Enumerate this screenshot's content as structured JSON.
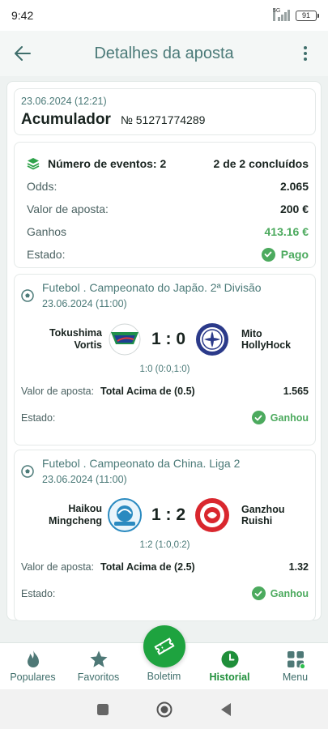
{
  "status_bar": {
    "time": "9:42",
    "network": "5G",
    "battery": "91"
  },
  "header": {
    "title": "Detalhes da aposta",
    "back_icon": "arrow-left-icon",
    "menu_icon": "more-vertical-icon"
  },
  "bet": {
    "date": "23.06.2024 (12:21)",
    "type": "Acumulador",
    "number": "№ 51271774289"
  },
  "summary": {
    "events_label": "Número de eventos: 2",
    "events_status": "2 de 2 concluídos",
    "rows": [
      {
        "label": "Odds:",
        "value": "2.065"
      },
      {
        "label": "Valor de aposta:",
        "value": "200 €"
      },
      {
        "label": "Ganhos",
        "value": "413.16 €"
      },
      {
        "label": "Estado:",
        "value": "Pago"
      }
    ]
  },
  "events": [
    {
      "league": "Futebol . Campeonato do Japão. 2ª Divisão",
      "date": "23.06.2024 (11:00)",
      "home": "Tokushima Vortis",
      "score": "1 : 0",
      "away": "Mito HollyHock",
      "ht_score": "1:0 (0:0,1:0)",
      "stake_label": "Valor de aposta:",
      "market": "Total Acima de (0.5)",
      "odd": "1.565",
      "state_label": "Estado:",
      "state": "Ganhou"
    },
    {
      "league": "Futebol . Campeonato da China. Liga 2",
      "date": "23.06.2024 (11:00)",
      "home": "Haikou Mingcheng",
      "score": "1 : 2",
      "away": "Ganzhou Ruishi",
      "ht_score": "1:2 (1:0,0:2)",
      "stake_label": "Valor de aposta:",
      "market": "Total Acima de (2.5)",
      "odd": "1.32",
      "state_label": "Estado:",
      "state": "Ganhou"
    }
  ],
  "nav": [
    {
      "label": "Populares",
      "icon": "flame-icon"
    },
    {
      "label": "Favoritos",
      "icon": "star-icon"
    },
    {
      "label": "Boletim",
      "icon": "ticket-icon"
    },
    {
      "label": "Historial",
      "icon": "clock-icon",
      "active": true
    },
    {
      "label": "Menu",
      "icon": "menu-grid-icon"
    }
  ],
  "colors": {
    "accent": "#4b7a78",
    "win": "#4caa5e",
    "fab": "#1ea33f",
    "active_nav": "#1f8f3a"
  }
}
